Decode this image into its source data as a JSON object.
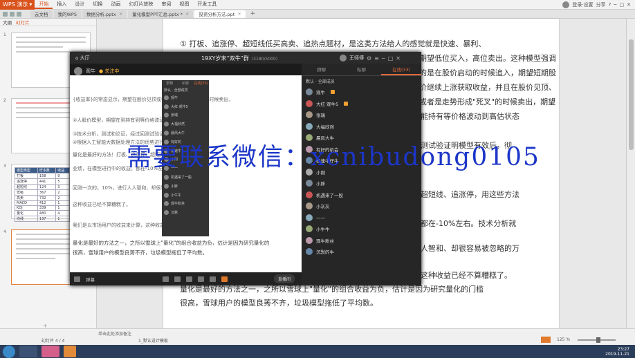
{
  "app": {
    "logo_label": "WPS 演示",
    "menus": [
      "开始",
      "插入",
      "设计",
      "切换",
      "动画",
      "幻灯片放映",
      "审阅",
      "视图",
      "开发工具"
    ],
    "active_menu": "开始",
    "right": {
      "user": "登录·设置",
      "share": "分享",
      "help": "?"
    }
  },
  "tabs": [
    {
      "label": "云文档"
    },
    {
      "label": "我的WPS"
    },
    {
      "label": "数据分析.pptx"
    },
    {
      "label": "量化模型PPT汇总.pptx *"
    },
    {
      "label": "投资分析方法.ppt",
      "active": true
    }
  ],
  "leftpane": {
    "tabs": [
      "大纲",
      "幻灯片"
    ],
    "active_tab": "幻灯片",
    "slide_numbers": [
      "1",
      "2",
      "3",
      "4"
    ],
    "table_rows": [
      [
        "模型类型",
        "样本数",
        "收益"
      ],
      [
        "打板",
        "158",
        "9"
      ],
      [
        "追涨停",
        "441",
        "5"
      ],
      [
        "超短线",
        "124",
        "3"
      ],
      [
        "低吸",
        "367",
        "2"
      ],
      [
        "高卖",
        "732",
        "2"
      ],
      [
        "MACD",
        "412",
        "1"
      ],
      [
        "KDJ",
        "339",
        "1"
      ],
      [
        "量化",
        "480",
        "4"
      ],
      [
        "均线",
        "137",
        "1"
      ]
    ]
  },
  "document": {
    "paragraphs": [
      "① 打板、追涨停、超短线低买高卖、追热点题材，是这类方法给人的感觉就是快速、暴利、",
      "期望低位买入，高位卖出。这种模型强调的是在股价启动的时候追入，期望短期股",
      "价继续上涨获取收益，并且在股价见顶、或者是走势形成\"死叉\"的时候卖出，期望",
      "能持有等价格波动到高估状态",
      "测试验证明模型有效后，彻",
      "超短线、追涨停，用这些方法",
      "都在-10%左右。技术分析就",
      "人智和、却很容易被忽略的万",
      "这种收益已经不算糟糕了。",
      "量化是最好的方法之一，之所以雪球上\"量化\"的组合收益为负，估计是因为研究量化的门槛",
      "很高，雪球用户的模型良莠不齐，垃圾模型拖低了平均数。"
    ]
  },
  "live": {
    "home_label": "大厅",
    "room_title": "19XY岁末“双牛”群",
    "room_count": "(3180/5000)",
    "user_name": "王师傅",
    "anchor_name": "观牛",
    "follow_label": "关注中",
    "video_lines": [
      "{收益率}的常态显示，期望在股价见顶或者是走势形成\"死叉\"的时候卖出，",
      "②人股价模型，期望在到持有到等价格波动到高估状态",
      "③技术分析，测试和论证，经过回测试验证明模型有效后，",
      "④根据人工智能大数据处理方法的优势进行分析结论",
      "量化是最好的方法！打板、追涨停、超短线，用这些方法",
      "业绩，在模型进行中的收益，都在-10%左右。",
      "回测一次的，10%，进行人人智和、却很容易被忽略",
      "这种收益已经不算糟糕了。",
      "我们是以市场用户的收益来计算，这种收益已经",
      "量化是最好的方法之一，之所以雪球上\"量化\"的组合收益为负，估计是因为研究量化的",
      "很高，雪球用户的模型良莠不齐，垃圾模型拖低了平均数。"
    ],
    "video_bar": {
      "chat_label": "弹幕",
      "live_btn": "直播间"
    },
    "chat_tabs": [
      "群聊",
      "私聊",
      "在线(33)"
    ],
    "active_chat_tab": "在线(33)",
    "filter_label": "默认 · 全部成员",
    "members": [
      {
        "name": "观牛",
        "badge": true
      },
      {
        "name": "大红·观牛5",
        "badge": true
      },
      {
        "name": "张瑞"
      },
      {
        "name": "大福欣然"
      },
      {
        "name": "晨风大牛"
      },
      {
        "name": "有好的机会"
      },
      {
        "name": "极速牛仔牛"
      },
      {
        "name": "小刚"
      },
      {
        "name": "小胖"
      },
      {
        "name": "机遇来了一股"
      },
      {
        "name": "小灰灰"
      },
      {
        "name": "一一"
      },
      {
        "name": "小牛牛"
      },
      {
        "name": "观牛粉丝"
      },
      {
        "name": "沉默的牛"
      }
    ],
    "mini_tabs": [
      "群聊",
      "私聊",
      "在线(33)"
    ],
    "mini_filter": "默认 · 全部成员",
    "mini_members": [
      "观牛",
      "大红·观牛5",
      "张瑞",
      "大福欣然",
      "晨风大牛",
      "有好的",
      "极速牛",
      "小刚",
      "一一",
      "机遇来了一股",
      "小胖",
      "小牛牛",
      "观牛粉丝",
      "沉默"
    ]
  },
  "watermark": "需要联系微信：xcnibudong0105",
  "statusbar": {
    "notes": "单击此处添加备注",
    "slide_info": "幻灯片 4 / 4",
    "theme": "1_默认设计模板",
    "zoom": "125 %"
  },
  "taskbar": {
    "time": "23:27",
    "date": "2019-11-21"
  }
}
